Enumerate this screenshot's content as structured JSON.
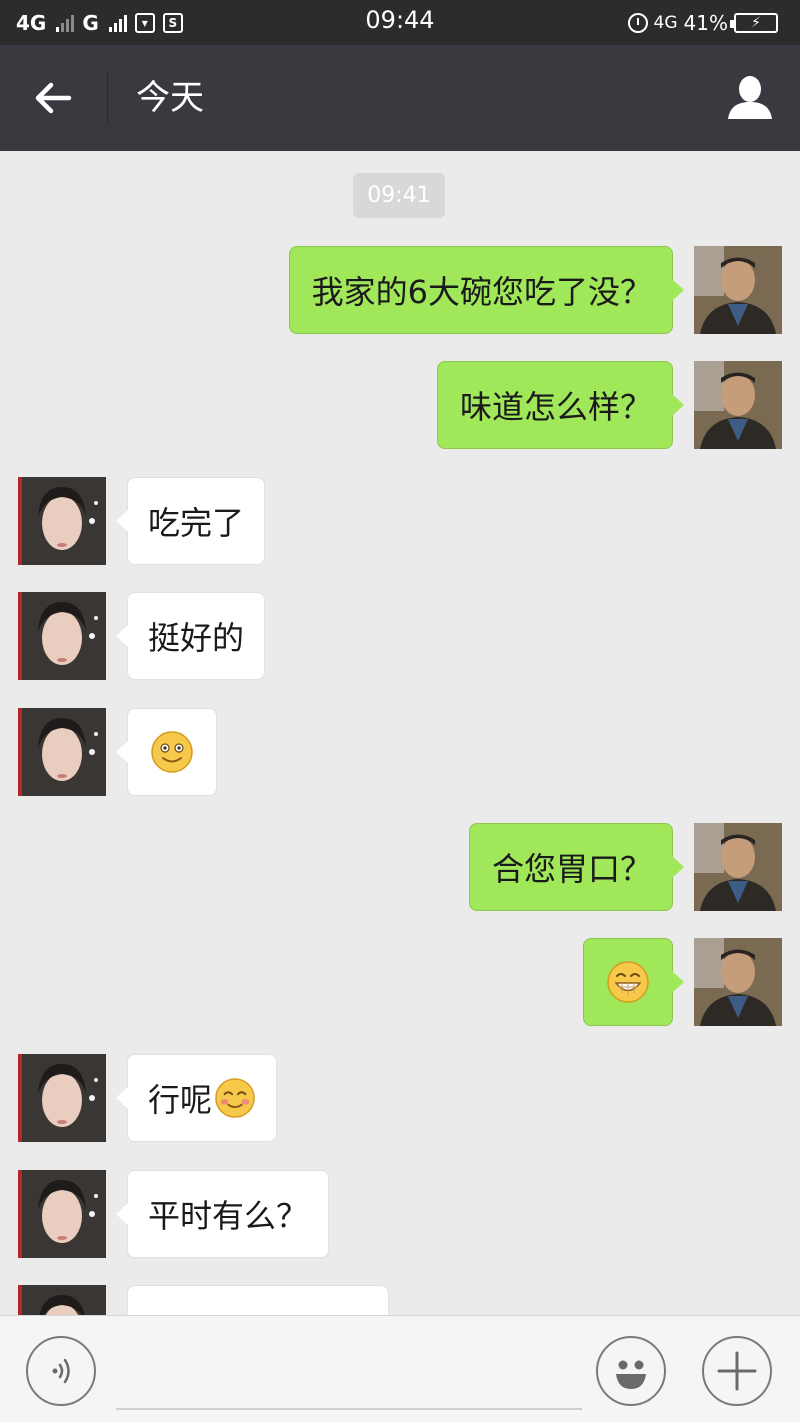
{
  "status_bar": {
    "left_net1": "4G",
    "left_net2": "G",
    "time": "09:44",
    "right_net": "4G",
    "battery": "41%"
  },
  "header": {
    "title": "今天"
  },
  "timestamp": "09:41",
  "messages": [
    {
      "side": "out",
      "text": "我家的6大碗您吃了没？"
    },
    {
      "side": "out",
      "text": "味道怎么样？"
    },
    {
      "side": "in",
      "text": "吃完了"
    },
    {
      "side": "in",
      "text": "挺好的"
    },
    {
      "side": "in",
      "text": "",
      "emoji": "smile-emoji"
    },
    {
      "side": "out",
      "text": "合您胃口？"
    },
    {
      "side": "out",
      "text": "",
      "emoji": "grin-emoji"
    },
    {
      "side": "in",
      "text": "行呢",
      "emoji": "blush-emoji"
    },
    {
      "side": "in",
      "text": "平时有么？"
    }
  ],
  "input": {
    "value": ""
  },
  "colors": {
    "outgoing_bubble": "#a0e75a",
    "incoming_bubble": "#ffffff",
    "header_bg": "#393a3f",
    "chat_bg": "#ebebeb"
  }
}
